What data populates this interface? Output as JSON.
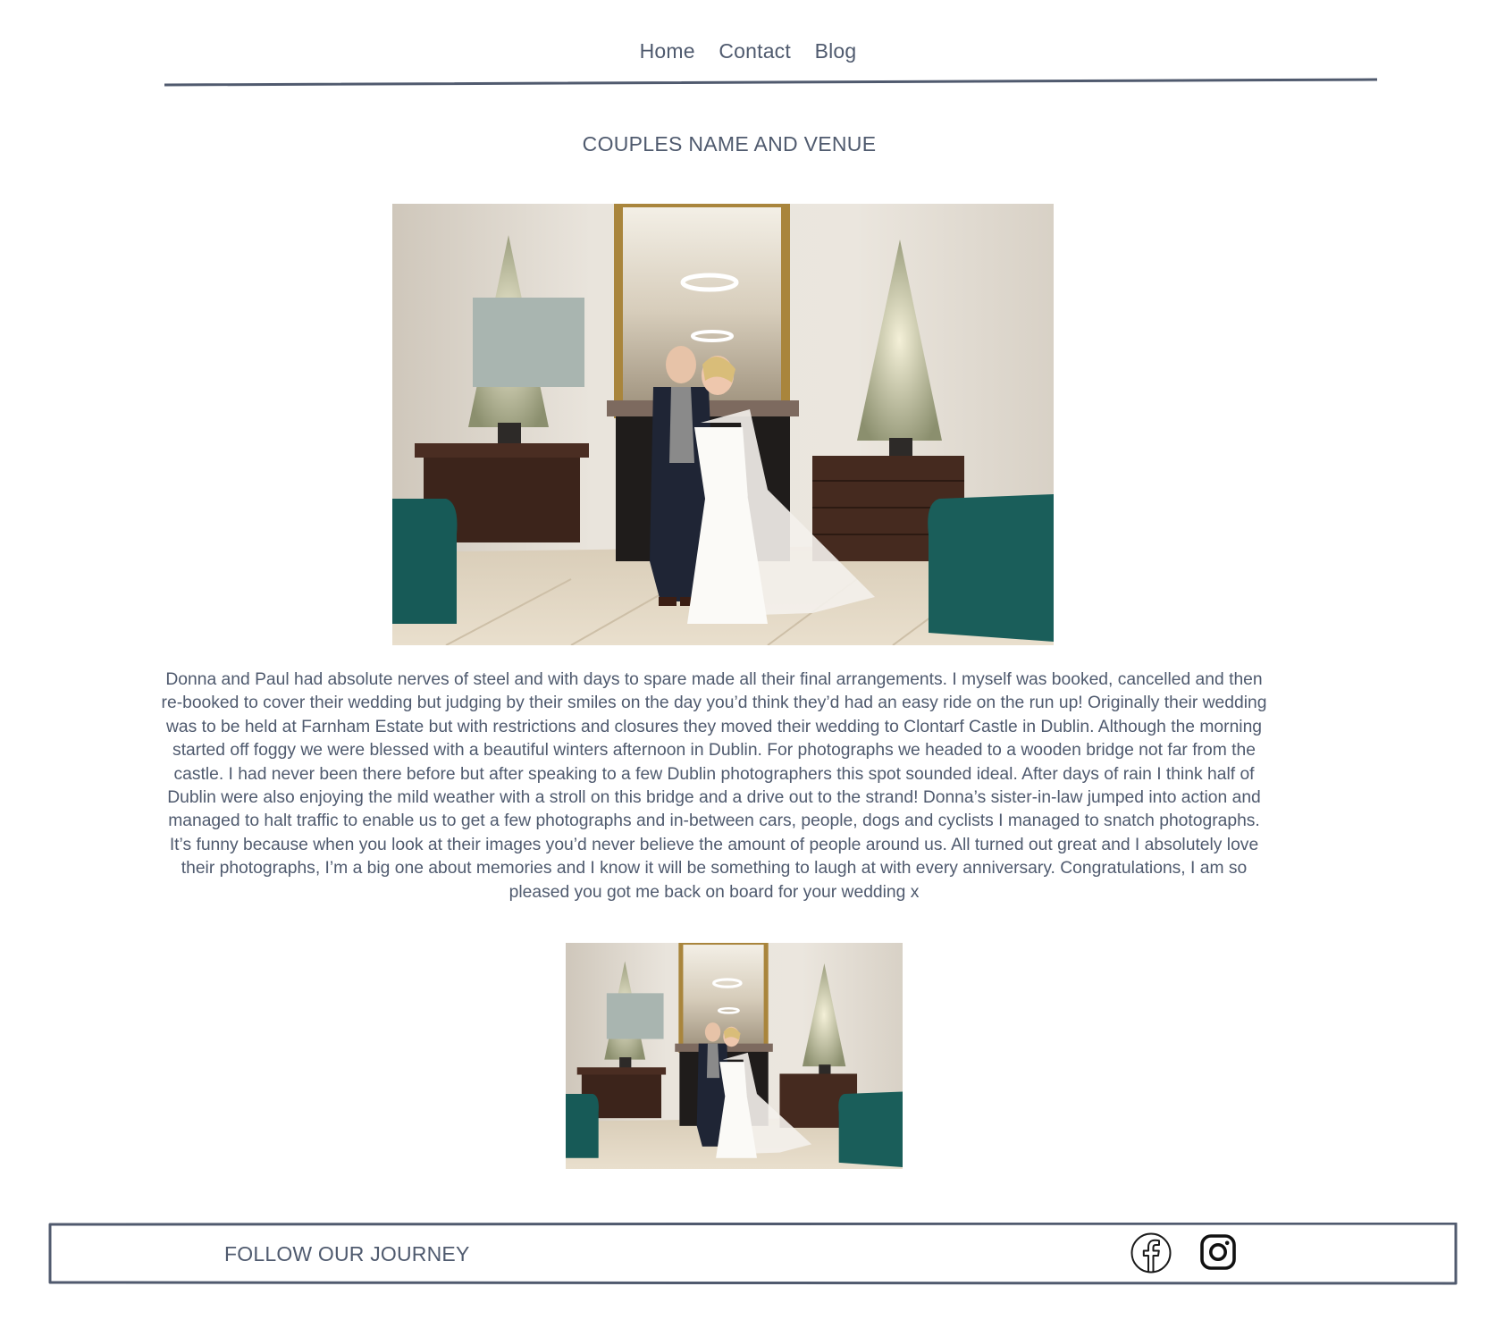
{
  "nav": {
    "items": [
      {
        "label": "Home"
      },
      {
        "label": "Contact"
      },
      {
        "label": "Blog"
      }
    ]
  },
  "post": {
    "title": "COUPLES NAME AND VENUE",
    "body": "Donna and Paul had absolute nerves of steel and with days to spare made all their final arrangements. I myself was booked, cancelled and then re-booked to cover their wedding but judging by their smiles on the day you’d think they’d had an easy ride on the run up! Originally their wedding was to be held at Farnham Estate but with restrictions and closures they moved their wedding to Clontarf Castle in Dublin. Although the morning started off foggy we were blessed with a beautiful winters afternoon in Dublin. For photographs we headed to a wooden bridge not far from the castle. I had never been there before but after speaking to a few Dublin photographers this spot sounded ideal. After days of rain I think half of Dublin were also enjoying the mild weather with a stroll on this bridge and a drive out to the strand! Donna’s sister-in-law jumped into action and managed to halt traffic to enable us to get a few photographs and in-between cars, people, dogs and cyclists I managed to snatch photographs. It’s funny because when you look at their images you’d never believe the amount of people around us. All turned out great and I absolutely love their photographs, I’m a big one about memories and I know it will be something to laugh at with every anniversary. Congratulations, I am so pleased you got me back on board for your wedding x"
  },
  "footer": {
    "label": "FOLLOW OUR JOURNEY",
    "social": [
      {
        "icon": "facebook-icon"
      },
      {
        "icon": "instagram-icon"
      }
    ]
  },
  "colors": {
    "text": "#4f5a6e",
    "rule": "#4f5a6e",
    "background": "#ffffff"
  }
}
